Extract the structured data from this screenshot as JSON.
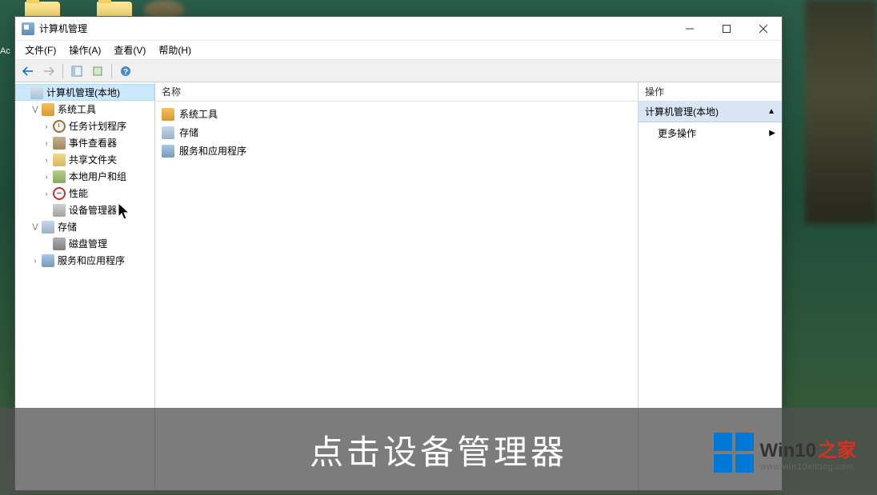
{
  "window": {
    "title": "计算机管理"
  },
  "menubar": {
    "file": "文件(F)",
    "action": "操作(A)",
    "view": "查看(V)",
    "help": "帮助(H)"
  },
  "tree": {
    "root": "计算机管理(本地)",
    "sysTools": "系统工具",
    "taskSched": "任务计划程序",
    "eventViewer": "事件查看器",
    "sharedFolders": "共享文件夹",
    "localUsers": "本地用户和组",
    "performance": "性能",
    "deviceMgr": "设备管理器",
    "storage": "存储",
    "diskMgmt": "磁盘管理",
    "services": "服务和应用程序"
  },
  "list": {
    "header": "名称",
    "items": [
      {
        "label": "系统工具",
        "icon": "toolbox"
      },
      {
        "label": "存储",
        "icon": "storage"
      },
      {
        "label": "服务和应用程序",
        "icon": "services"
      }
    ]
  },
  "actions": {
    "header": "操作",
    "section": "计算机管理(本地)",
    "more": "更多操作"
  },
  "overlay": {
    "caption": "点击设备管理器"
  },
  "watermark": {
    "title1": "Win10",
    "title2": "之家",
    "url": "www.win10xitong.com"
  },
  "leftLabel": "Ac"
}
